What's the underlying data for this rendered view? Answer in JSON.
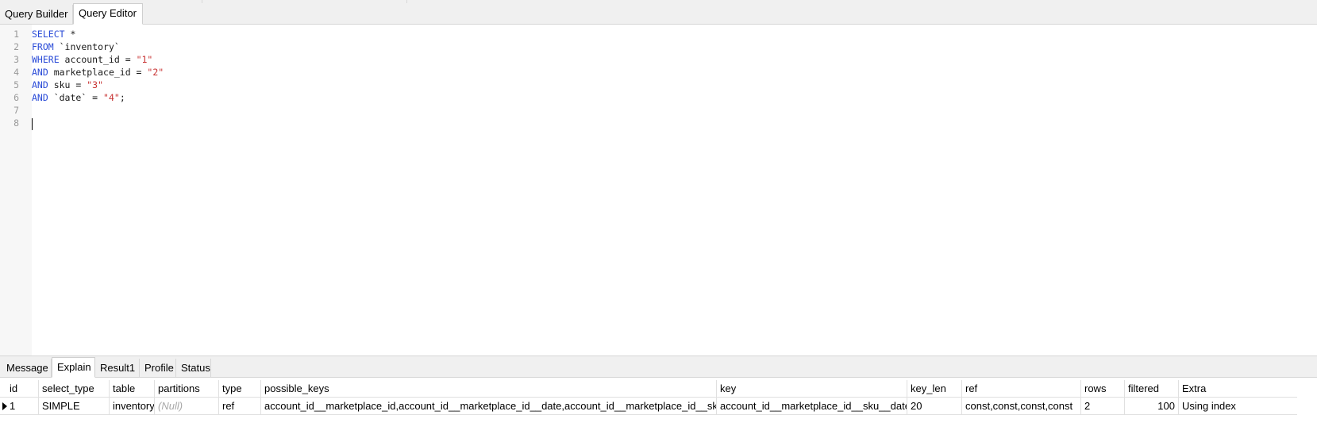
{
  "top_tabs": [
    {
      "label": "Query Builder",
      "active": false
    },
    {
      "label": "Query Editor",
      "active": true
    }
  ],
  "editor": {
    "line_numbers": [
      "1",
      "2",
      "3",
      "4",
      "5",
      "6",
      "7",
      "8"
    ],
    "lines": [
      [
        {
          "t": "SELECT",
          "c": "kw"
        },
        {
          "t": " *",
          "c": ""
        }
      ],
      [
        {
          "t": "FROM",
          "c": "kw"
        },
        {
          "t": " `inventory`",
          "c": ""
        }
      ],
      [
        {
          "t": "WHERE",
          "c": "kw"
        },
        {
          "t": " account_id = ",
          "c": ""
        },
        {
          "t": "\"1\"",
          "c": "str"
        }
      ],
      [
        {
          "t": "AND",
          "c": "kw"
        },
        {
          "t": " marketplace_id = ",
          "c": ""
        },
        {
          "t": "\"2\"",
          "c": "str"
        }
      ],
      [
        {
          "t": "AND",
          "c": "kw"
        },
        {
          "t": " sku = ",
          "c": ""
        },
        {
          "t": "\"3\"",
          "c": "str"
        }
      ],
      [
        {
          "t": "AND",
          "c": "kw"
        },
        {
          "t": " `date` = ",
          "c": ""
        },
        {
          "t": "\"4\"",
          "c": "str"
        },
        {
          "t": ";",
          "c": ""
        }
      ],
      [],
      []
    ]
  },
  "result_tabs": [
    {
      "label": "Message",
      "active": false
    },
    {
      "label": "Explain",
      "active": true
    },
    {
      "label": "Result1",
      "active": false
    },
    {
      "label": "Profile",
      "active": false
    },
    {
      "label": "Status",
      "active": false
    }
  ],
  "explain": {
    "columns": [
      "id",
      "select_type",
      "table",
      "partitions",
      "type",
      "possible_keys",
      "key",
      "key_len",
      "ref",
      "rows",
      "filtered",
      "Extra"
    ],
    "rows": [
      [
        "1",
        "SIMPLE",
        "inventory",
        "(Null)",
        "ref",
        "account_id__marketplace_id,account_id__marketplace_id__date,account_id__marketplace_id__sku__date",
        "account_id__marketplace_id__sku__date",
        "20",
        "const,const,const,const",
        "2",
        "100",
        "Using index"
      ]
    ]
  }
}
